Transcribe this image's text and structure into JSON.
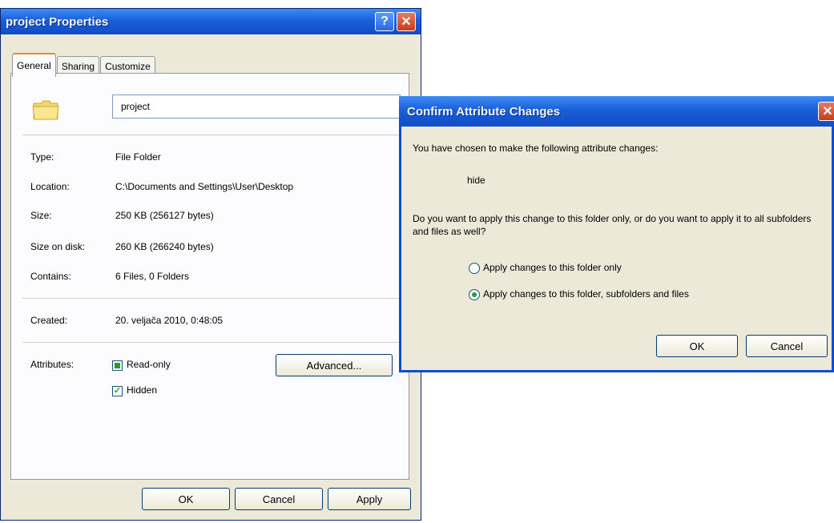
{
  "properties_window": {
    "title": "project Properties",
    "help_label": "?",
    "close_label": "✕",
    "tabs": [
      "General",
      "Sharing",
      "Customize"
    ],
    "active_tab": "General",
    "folder_name": "project",
    "rows": [
      {
        "label": "Type:",
        "value": "File Folder"
      },
      {
        "label": "Location:",
        "value": "C:\\Documents and Settings\\User\\Desktop"
      },
      {
        "label": "Size:",
        "value": "250 KB (256127 bytes)"
      },
      {
        "label": "Size on disk:",
        "value": "260 KB (266240 bytes)"
      },
      {
        "label": "Contains:",
        "value": "6 Files, 0 Folders"
      }
    ],
    "created": {
      "label": "Created:",
      "value": "20. veljača 2010, 0:48:05"
    },
    "attributes_label": "Attributes:",
    "read_only_label": "Read-only",
    "read_only_state": "indeterminate",
    "hidden_label": "Hidden",
    "hidden_state": "checked",
    "advanced_button": "Advanced...",
    "ok_button": "OK",
    "cancel_button": "Cancel",
    "apply_button": "Apply",
    "folder_icon": "folder-icon"
  },
  "confirm_dialog": {
    "title": "Confirm Attribute Changes",
    "close_label": "✕",
    "intro": "You have chosen to make the following attribute changes:",
    "change": "hide",
    "question": "Do you want to apply this change to this folder only, or do you want to apply it to all subfolders and files as well?",
    "options": [
      {
        "label": "Apply changes to this folder only",
        "selected": false
      },
      {
        "label": "Apply changes to this folder, subfolders and files",
        "selected": true
      }
    ],
    "ok_button": "OK",
    "cancel_button": "Cancel"
  },
  "colors": {
    "titlebar": "#0f4cc8",
    "window_bg": "#ece9d8",
    "checkbox_mark": "#21a121",
    "close_button": "#c83c1d"
  }
}
